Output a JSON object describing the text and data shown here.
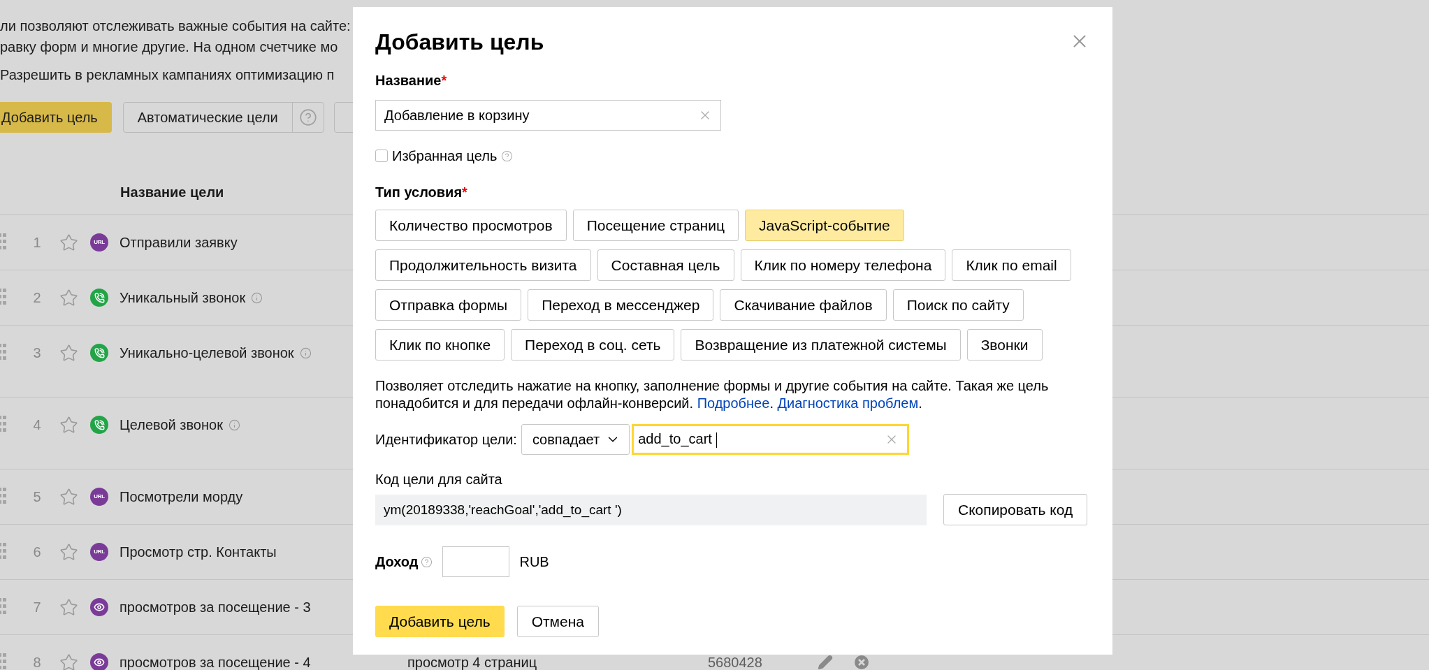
{
  "intro_lines": [
    "ли позволяют отслеживать важные события на сайте:",
    "равку форм и многие другие. На одном счетчике мо"
  ],
  "optimization_option": "Разрешить в рекламных кампаниях оптимизацию п",
  "toolbar": {
    "add_button": "Добавить цель",
    "auto_goals_button": "Автоматические цели"
  },
  "goals_table": {
    "name_header": "Название цели",
    "rows": [
      {
        "number": "1",
        "favorite": false,
        "kind": "url",
        "badge": "URL",
        "name": "Отправили заявку",
        "info": false
      },
      {
        "number": "2",
        "favorite": false,
        "kind": "call",
        "name": "Уникальный звонок",
        "info": true
      },
      {
        "number": "3",
        "favorite": false,
        "kind": "call",
        "name": "Уникально-целевой звонок",
        "info": true
      },
      {
        "number": "4",
        "favorite": false,
        "kind": "call",
        "name": "Целевой звонок",
        "info": true
      },
      {
        "number": "5",
        "favorite": false,
        "kind": "url",
        "badge": "URL",
        "name": "Посмотрели морду",
        "info": false
      },
      {
        "number": "6",
        "favorite": false,
        "kind": "url",
        "badge": "URL",
        "name": "Просмотр стр. Контакты",
        "info": false
      },
      {
        "number": "7",
        "favorite": false,
        "kind": "views",
        "name": "просмотров за посещение - 3",
        "info": false
      },
      {
        "number": "8",
        "favorite": false,
        "kind": "views",
        "name": "просмотров за посещение - 4",
        "info": false,
        "condition": "просмотр 4 страниц",
        "goal_id": "5680428"
      }
    ]
  },
  "dialog": {
    "title": "Добавить цель",
    "name_label": {
      "text": "Название",
      "mark": "*"
    },
    "name_value": "Добавление в корзину",
    "favorite": {
      "label": "Избранная цель",
      "checked": false
    },
    "condition_label": {
      "text": "Тип условия",
      "mark": "*"
    },
    "condition_types": [
      {
        "label": "Количество просмотров",
        "selected": false
      },
      {
        "label": "Посещение страниц",
        "selected": false
      },
      {
        "label": "JavaScript-событие",
        "selected": true
      },
      {
        "label": "Продолжительность визита",
        "selected": false
      },
      {
        "label": "Составная цель",
        "selected": false
      },
      {
        "label": "Клик по номеру телефона",
        "selected": false
      },
      {
        "label": "Клик по email",
        "selected": false
      },
      {
        "label": "Отправка формы",
        "selected": false
      },
      {
        "label": "Переход в мессенджер",
        "selected": false
      },
      {
        "label": "Скачивание файлов",
        "selected": false
      },
      {
        "label": "Поиск по сайту",
        "selected": false
      },
      {
        "label": "Клик по кнопке",
        "selected": false
      },
      {
        "label": "Переход в соц. сеть",
        "selected": false
      },
      {
        "label": "Возвращение из платежной системы",
        "selected": false
      },
      {
        "label": "Звонки",
        "selected": false
      }
    ],
    "description": [
      {
        "kind": "text",
        "text": "Позволяет отследить нажатие на кнопку, заполнение формы и другие события на сайте. Такая же цель понадобится и для передачи офлайн-конверсий. "
      },
      {
        "kind": "link",
        "text": "Подробнее"
      },
      {
        "kind": "text",
        "text": ". "
      },
      {
        "kind": "link",
        "text": "Диагностика проблем"
      },
      {
        "kind": "text",
        "text": "."
      }
    ],
    "identifier": {
      "label": "Идентификатор цели:",
      "match": "совпадает",
      "value": "add_to_cart ",
      "focused": true
    },
    "code_label": "Код цели для сайта",
    "code": "ym(20189338,'reachGoal','add_to_cart ')",
    "copy_button": "Скопировать код",
    "revenue": {
      "label": "Доход",
      "currency": "RUB"
    },
    "submit_button": "Добавить цель",
    "cancel_button": "Отмена"
  }
}
